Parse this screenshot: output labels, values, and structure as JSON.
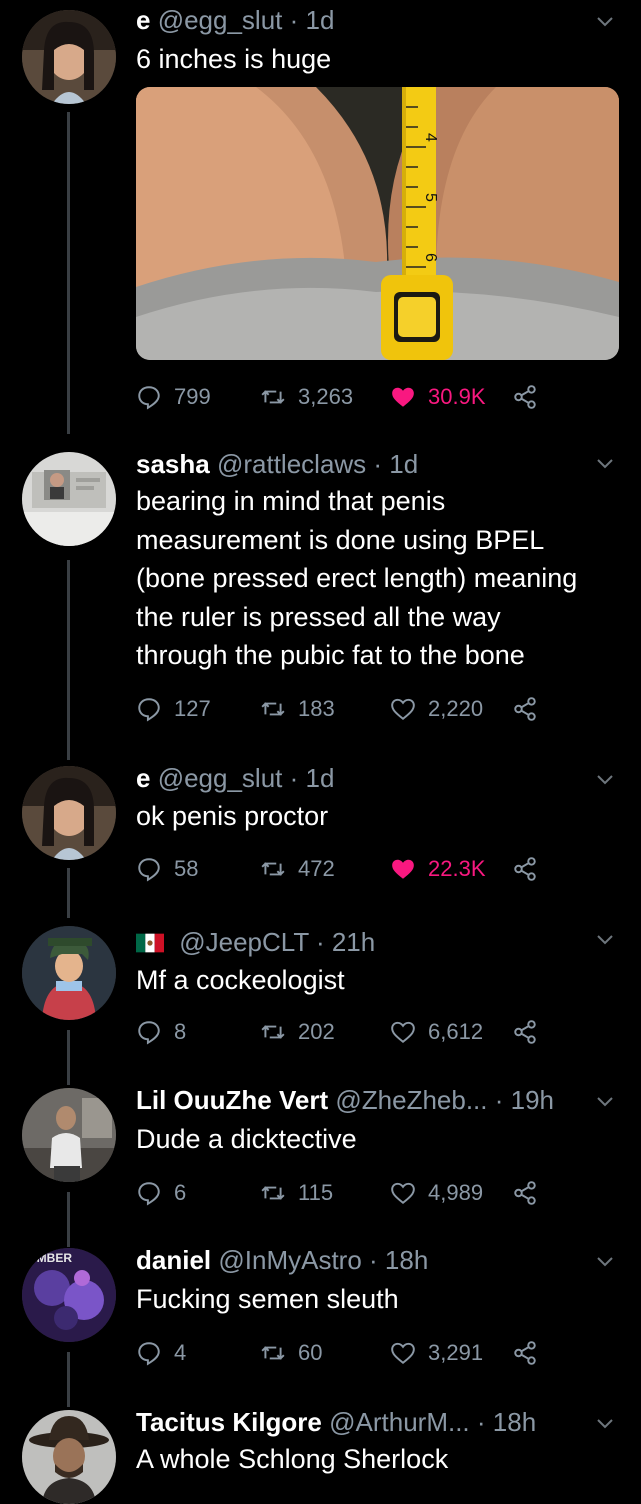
{
  "tweets": [
    {
      "display_name": "e",
      "handle": "@egg_slut",
      "time": "· 1d",
      "text": "6 inches is huge",
      "replies": "799",
      "retweets": "3,263",
      "likes": "30.9K",
      "liked": true
    },
    {
      "display_name": "sasha",
      "handle": "@rattleclaws",
      "time": "· 1d",
      "text_lines": [
        "bearing in mind that penis",
        "measurement is done using BPEL",
        "(bone pressed erect length) meaning",
        "the ruler is pressed all the way",
        "through the pubic fat to the bone"
      ],
      "replies": "127",
      "retweets": "183",
      "likes": "2,220",
      "liked": false
    },
    {
      "display_name": "e",
      "handle": "@egg_slut",
      "time": "· 1d",
      "text": "ok penis proctor",
      "replies": "58",
      "retweets": "472",
      "likes": "22.3K",
      "liked": true
    },
    {
      "display_name": "",
      "handle": "@JeepCLT",
      "time": "· 21h",
      "text": "Mf a cockeologist",
      "replies": "8",
      "retweets": "202",
      "likes": "6,612",
      "liked": false
    },
    {
      "display_name": "Lil OuuZhe Vert",
      "handle": "@ZheZheb...",
      "time": "· 19h",
      "text": "Dude a dicktective",
      "replies": "6",
      "retweets": "115",
      "likes": "4,989",
      "liked": false
    },
    {
      "display_name": "daniel",
      "handle": "@InMyAstro",
      "time": "· 18h",
      "text": "Fucking semen sleuth",
      "replies": "4",
      "retweets": "60",
      "likes": "3,291",
      "liked": false
    },
    {
      "display_name": "Tacitus Kilgore",
      "handle": "@ArthurM...",
      "time": "· 18h",
      "text": "A whole Schlong Sherlock"
    }
  ],
  "media": {
    "ruler_marks": [
      "4",
      "5",
      "6"
    ]
  },
  "avatar_text": {
    "daniel": "UMBER"
  },
  "colors": {
    "background": "#000000",
    "secondary_text": "#8b98a5",
    "like_active": "#f91880",
    "thread_line": "#3a3f44"
  },
  "icons": [
    "reply-icon",
    "retweet-icon",
    "heart-icon",
    "share-icon",
    "chevron-down-icon",
    "mexico-flag-icon"
  ]
}
